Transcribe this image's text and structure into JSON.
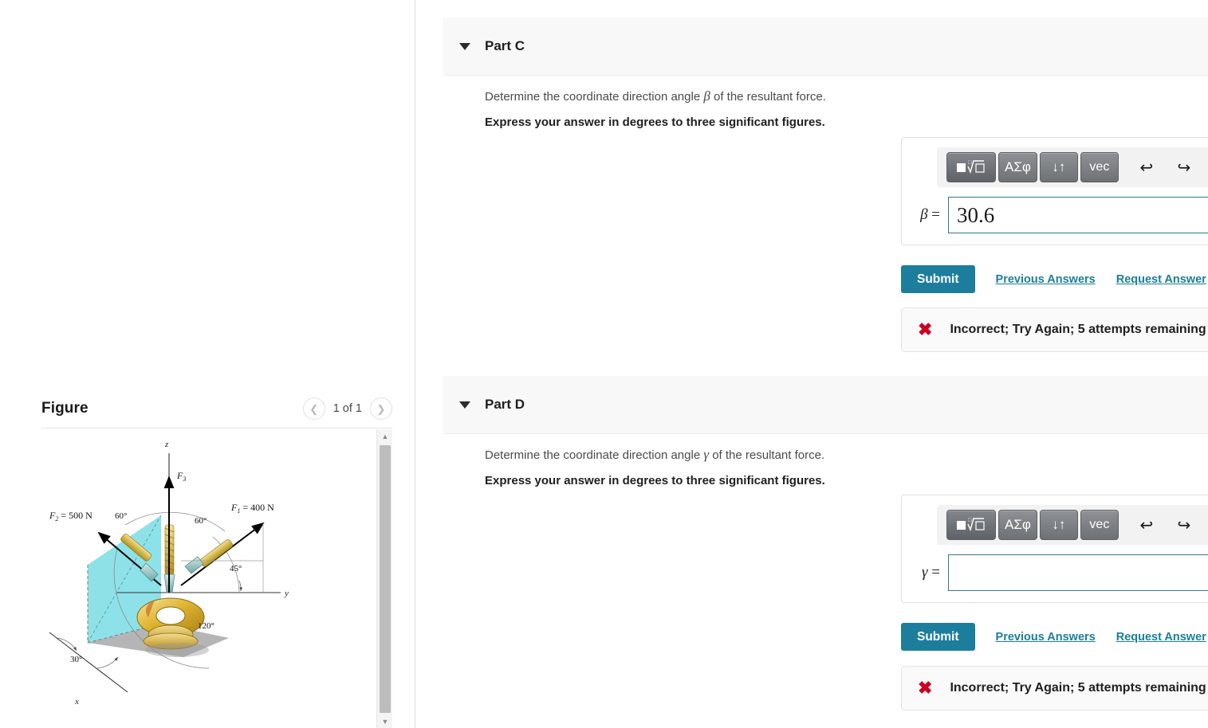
{
  "figure_panel": {
    "title": "Figure",
    "counter": "1 of 1",
    "prev_icon": "chevron-left-icon",
    "next_icon": "chevron-right-icon",
    "diagram": {
      "axes": [
        "z",
        "y",
        "x"
      ],
      "forces": [
        {
          "label": "F_3",
          "display": "F",
          "sub": "3"
        },
        {
          "label": "F_2 = 500 N",
          "display": "F",
          "sub": "2",
          "value": "= 500 N"
        },
        {
          "label": "F_1 = 400 N",
          "display": "F",
          "sub": "1",
          "value": "= 400 N"
        }
      ],
      "angles": [
        "60°",
        "60°",
        "45°",
        "120°",
        "30°"
      ]
    }
  },
  "parts": [
    {
      "id": "part-c",
      "label": "Part C",
      "caret_icon": "caret-down-icon",
      "question_prefix": "Determine the coordinate direction angle ",
      "question_symbol": "β",
      "question_suffix": " of the resultant force.",
      "instruction": "Express your answer in degrees to three significant figures.",
      "toolbar": {
        "radical_label": "√",
        "greek_label": "ΑΣφ",
        "arrows_label": "↓↑",
        "vec_label": "vec",
        "undo_icon": "undo-arrow-icon",
        "redo_icon": "redo-arrow-icon",
        "reset_icon": "reset-circular-arrow-icon",
        "keyboard_icon": "keyboard-icon",
        "help_label": "?"
      },
      "answer": {
        "symbol": "β",
        "equals": "=",
        "value": "30.6",
        "placeholder": "",
        "unit": "°"
      },
      "submit_label": "Submit",
      "previous_answers_label": "Previous Answers",
      "request_answer_label": "Request Answer",
      "feedback": {
        "icon": "x-mark-icon",
        "text": "Incorrect; Try Again; 5 attempts remaining"
      }
    },
    {
      "id": "part-d",
      "label": "Part D",
      "caret_icon": "caret-down-icon",
      "question_prefix": "Determine the coordinate direction angle ",
      "question_symbol": "γ",
      "question_suffix": " of the resultant force.",
      "instruction": "Express your answer in degrees to three significant figures.",
      "toolbar": {
        "radical_label": "√",
        "greek_label": "ΑΣφ",
        "arrows_label": "↓↑",
        "vec_label": "vec",
        "undo_icon": "undo-arrow-icon",
        "redo_icon": "redo-arrow-icon",
        "reset_icon": "reset-circular-arrow-icon",
        "keyboard_icon": "keyboard-icon",
        "help_label": "?"
      },
      "answer": {
        "symbol": "γ",
        "equals": "=",
        "value": "",
        "placeholder": "",
        "unit": "°"
      },
      "submit_label": "Submit",
      "previous_answers_label": "Previous Answers",
      "request_answer_label": "Request Answer",
      "feedback": {
        "icon": "x-mark-icon",
        "text": "Incorrect; Try Again; 5 attempts remaining"
      }
    }
  ],
  "colors": {
    "accent": "#1c7e9c",
    "error": "#cc0022",
    "input_border": "#2f7a8c",
    "header_bg": "#f8f8f8"
  },
  "scrollbar": {
    "up_icon": "triangle-up-icon",
    "down_icon": "triangle-down-icon"
  }
}
